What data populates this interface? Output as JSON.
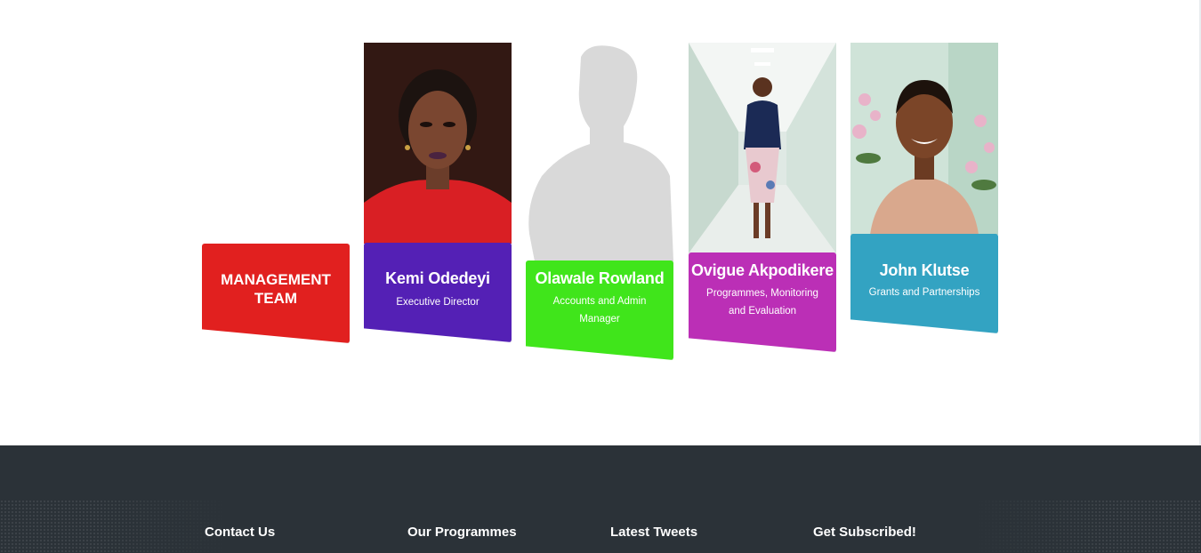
{
  "management": {
    "heading": "MANAGEMENT TEAM",
    "colors": {
      "heading": "#e1201f"
    },
    "members": [
      {
        "name": "Kemi Odedeyi",
        "role": "Executive Director",
        "color": "#5420b5",
        "photo": "woman-portrait-red-dress"
      },
      {
        "name": "Olawale Rowland",
        "role": "Accounts and Admin Manager",
        "color": "#40e51b",
        "photo": "silhouette-placeholder"
      },
      {
        "name": "Ovigue Akpodikere",
        "role": "Programmes, Monitoring and Evaluation",
        "color": "#bb2fb6",
        "photo": "woman-in-corridor"
      },
      {
        "name": "John Klutse",
        "role": "Grants and Partnerships",
        "color": "#33a3c2",
        "photo": "man-smiling-flowers"
      }
    ]
  },
  "footer": {
    "background": "#2b3238",
    "headings": [
      "Contact Us",
      "Our Programmes",
      "Latest Tweets",
      "Get Subscribed!"
    ]
  }
}
